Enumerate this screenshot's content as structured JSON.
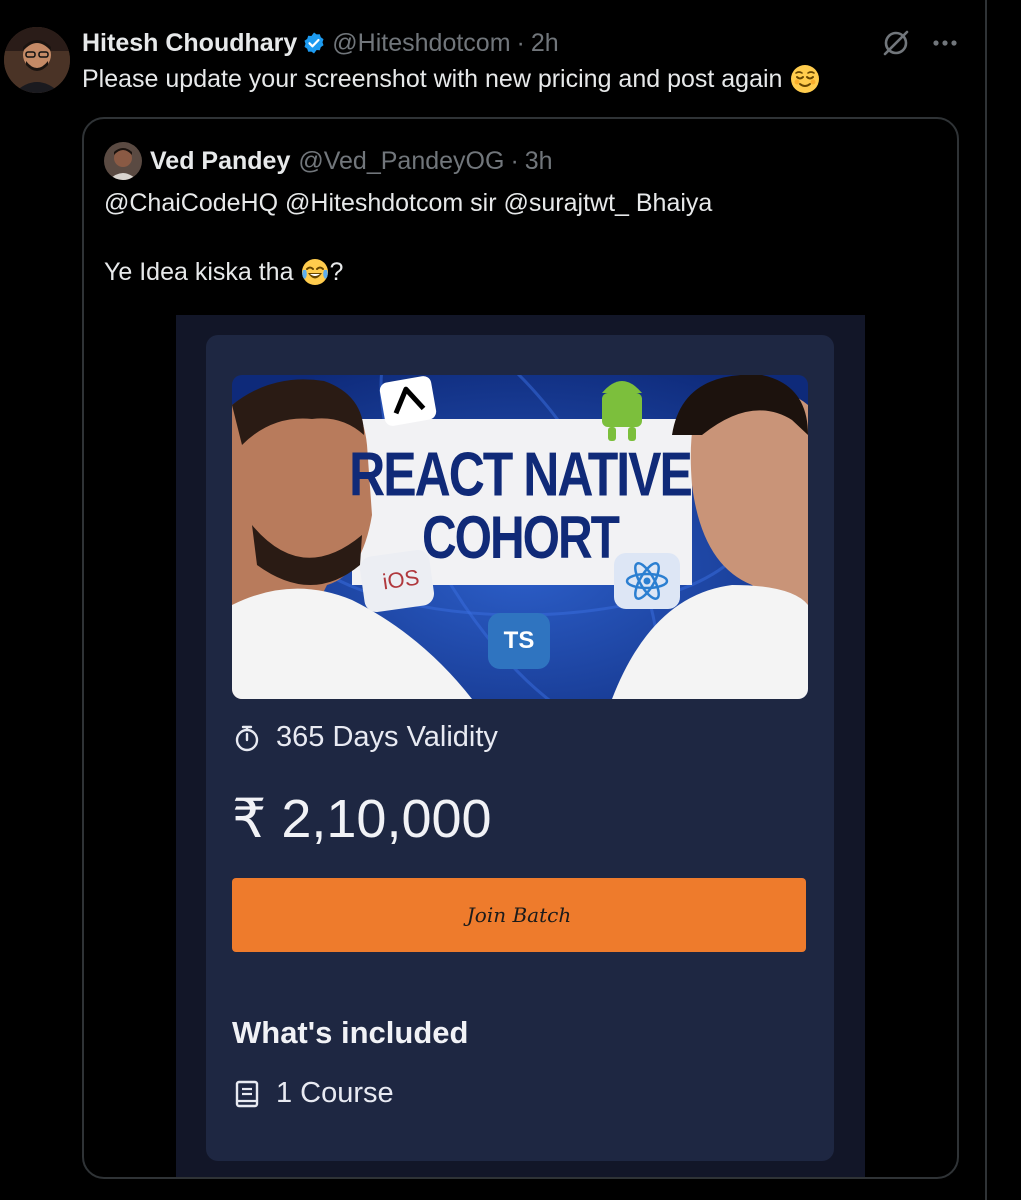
{
  "tweet": {
    "author_name": "Hitesh Choudhary",
    "author_handle": "@Hiteshdotcom",
    "separator": "·",
    "time": "2h",
    "text": "Please update your screenshot with new pricing and post again",
    "emoji_icon": "relieved-face-emoji",
    "verified_icon": "verified-badge-icon"
  },
  "quote": {
    "author_name": "Ved Pandey",
    "author_handle": "@Ved_PandeyOG",
    "separator": "·",
    "time": "3h",
    "line1": "@ChaiCodeHQ @Hiteshdotcom sir @surajtwt_ Bhaiya",
    "line2": "Ye Idea kiska tha",
    "line2_suffix": "?",
    "emoji_icon": "tears-of-joy-emoji"
  },
  "card": {
    "banner_title_line1": "REACT NATIVE",
    "banner_title_line2": "COHORT",
    "banner_badges": {
      "ios": "iOS",
      "ts": "TS"
    },
    "validity": "365 Days Validity",
    "price": "₹ 2,10,000",
    "cta_label": "Join Batch",
    "included_title": "What's included",
    "course_count": "1 Course"
  },
  "colors": {
    "background": "#000000",
    "card_background": "#1e2742",
    "accent_orange": "#ee7b2c",
    "verified_blue": "#1d9bf0",
    "muted_text": "#71767b"
  }
}
